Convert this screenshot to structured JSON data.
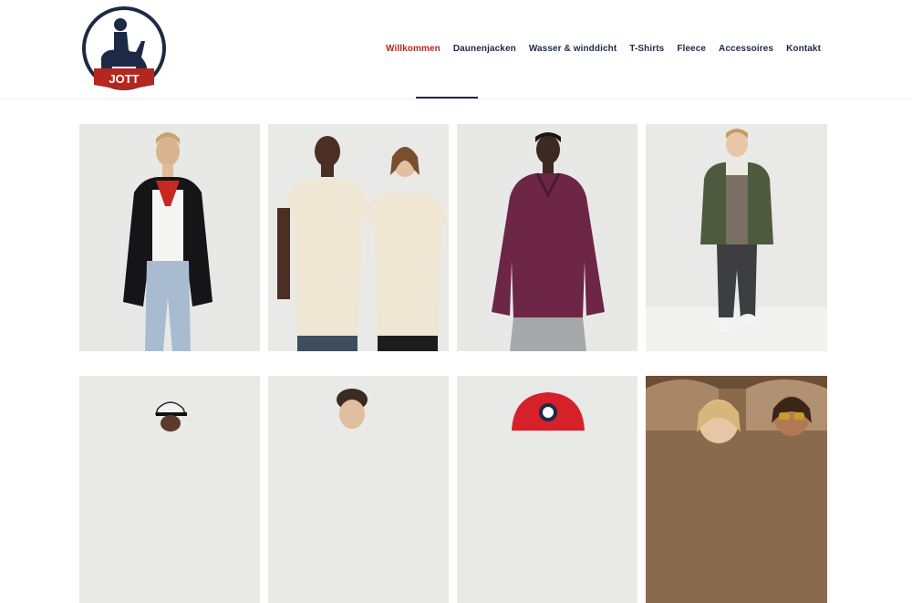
{
  "brand": {
    "logo_text": "JOTT",
    "colors": {
      "navy": "#1d2a46",
      "red": "#b5261e"
    }
  },
  "nav": {
    "items": [
      {
        "label": "Willkommen",
        "active": true
      },
      {
        "label": "Daunenjacken"
      },
      {
        "label": "Wasser & winddicht"
      },
      {
        "label": "T-Shirts"
      },
      {
        "label": "Fleece"
      },
      {
        "label": "Accessoires"
      },
      {
        "label": "Kontakt"
      }
    ]
  },
  "products": {
    "row1": [
      {
        "image": "woman-black-down-jacket-red-scarf"
      },
      {
        "image": "two-people-cream-t-shirts"
      },
      {
        "image": "woman-burgundy-half-zip-fleece"
      },
      {
        "image": "boy-khaki-puffer-jacket"
      }
    ],
    "row2": [
      {
        "image": "person-trucker-cap"
      },
      {
        "image": "man-portrait"
      },
      {
        "image": "red-cap-with-logo"
      },
      {
        "image": "two-people-sunglasses-outdoors"
      }
    ]
  }
}
